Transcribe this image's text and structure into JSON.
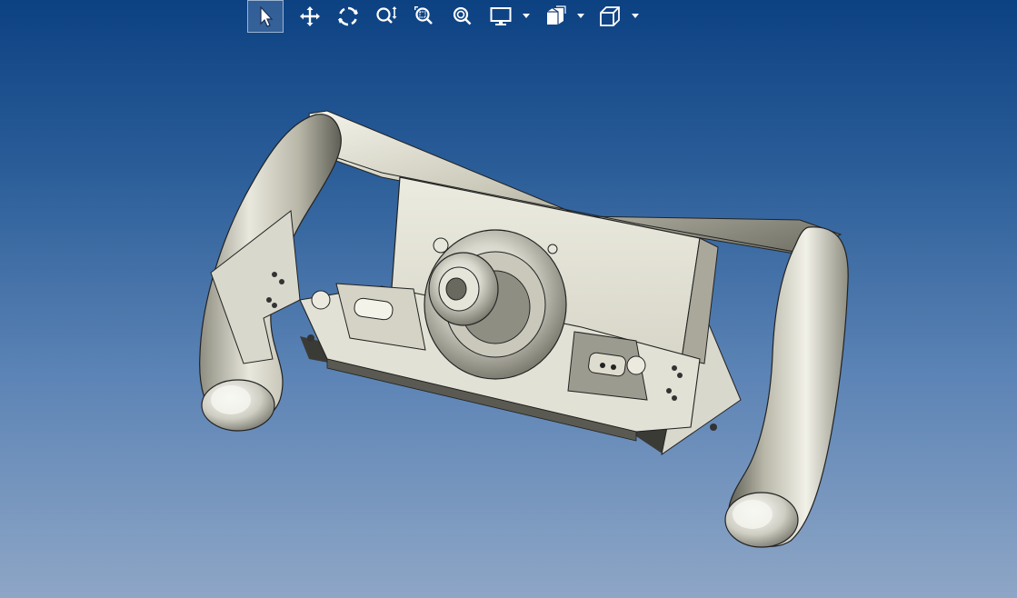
{
  "toolbar": {
    "tools": [
      {
        "id": "select",
        "icon": "select-arrow-icon",
        "active": true
      },
      {
        "id": "pan",
        "icon": "pan-move-icon",
        "active": false
      },
      {
        "id": "rotate",
        "icon": "rotate-icon",
        "active": false
      },
      {
        "id": "zoom-in-out",
        "icon": "zoom-in-out-icon",
        "active": false
      },
      {
        "id": "zoom-to-area",
        "icon": "zoom-to-area-icon",
        "active": false
      },
      {
        "id": "zoom-to-fit",
        "icon": "zoom-to-fit-icon",
        "active": false
      },
      {
        "id": "display-style",
        "icon": "monitor-display-icon",
        "has_dropdown": true
      },
      {
        "id": "section-view",
        "icon": "section-view-icon",
        "has_dropdown": true
      },
      {
        "id": "view-orientation",
        "icon": "view-cube-icon",
        "has_dropdown": true
      }
    ]
  },
  "viewport": {
    "background_top": "#0c4182",
    "background_bottom": "#8ea6c6",
    "model": "steering-wheel-assembly"
  }
}
